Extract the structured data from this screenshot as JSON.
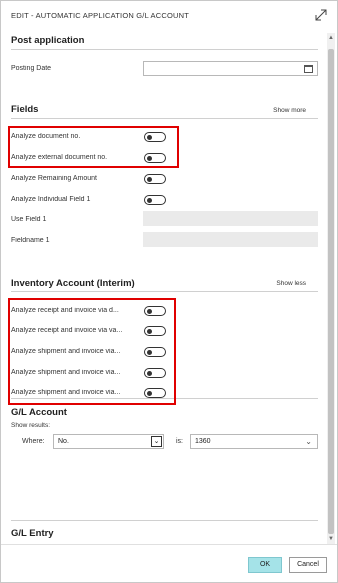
{
  "window": {
    "title": "EDIT - AUTOMATIC APPLICATION G/L ACCOUNT",
    "expand_icon": "expand-diagonal-icon"
  },
  "post_application": {
    "title": "Post application",
    "posting_date_label": "Posting Date",
    "posting_date_value": ""
  },
  "fields": {
    "title": "Fields",
    "show_link": "Show more",
    "rows": [
      {
        "label": "Analyze document no.",
        "type": "toggle",
        "value": false
      },
      {
        "label": "Analyze external document no.",
        "type": "toggle",
        "value": false
      },
      {
        "label": "Analyze Remaining Amount",
        "type": "toggle",
        "value": false
      },
      {
        "label": "Analyze Individual Field 1",
        "type": "toggle",
        "value": false
      },
      {
        "label": "Use Field 1",
        "type": "disabled",
        "value": ""
      },
      {
        "label": "Fieldname 1",
        "type": "disabled",
        "value": ""
      }
    ]
  },
  "inventory": {
    "title": "Inventory Account (Interim)",
    "show_link": "Show less",
    "rows": [
      {
        "label": "Analyze receipt and invoice via d...",
        "value": false
      },
      {
        "label": "Analyze receipt and invoice via va...",
        "value": false
      },
      {
        "label": "Analyze shipment and invoice via...",
        "value": false
      },
      {
        "label": "Analyze shipment and invoice via...",
        "value": false
      },
      {
        "label": "Analyze shipment and invoice via...",
        "value": false
      }
    ]
  },
  "gl_account": {
    "title": "G/L Account",
    "show_results": "Show results:",
    "where_label": "Where:",
    "where_value": "No.",
    "is_label": "is:",
    "is_value": "1360"
  },
  "gl_entry": {
    "title": "G/L Entry"
  },
  "footer": {
    "ok_label": "OK",
    "cancel_label": "Cancel"
  },
  "colors": {
    "highlight": "#e00000",
    "ok_button": "#a5e3e8"
  }
}
